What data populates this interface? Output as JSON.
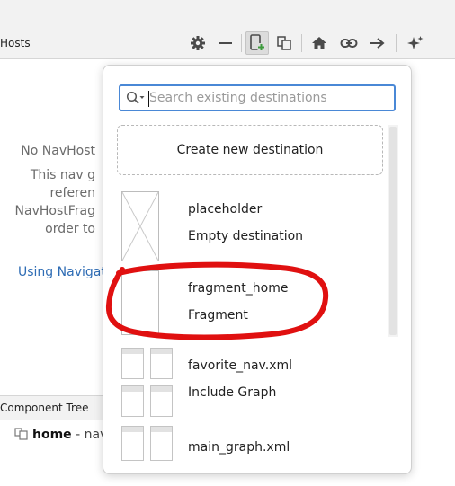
{
  "toolbar": {
    "title": "Hosts"
  },
  "host_panel": {
    "line1": "No NavHost",
    "line2": "This nav g",
    "line3": "referen",
    "line4": "NavHostFrag",
    "line5": "order to",
    "link": "Using Navigat"
  },
  "component_tree": {
    "title": "Component Tree",
    "row_name": "home",
    "row_suffix": "- nav"
  },
  "popup": {
    "search_placeholder": "Search existing destinations",
    "create_label": "Create new destination",
    "items": [
      {
        "name": "placeholder",
        "type": "Empty destination",
        "thumb": "empty-placeholder-thumbnail"
      },
      {
        "name": "fragment_home",
        "type": "Fragment",
        "thumb": "fragment-thumbnail"
      },
      {
        "name": "favorite_nav.xml",
        "type": "Include Graph",
        "thumb": "graph-thumbnail"
      },
      {
        "name": "main_graph.xml",
        "type": "",
        "thumb": "graph-thumbnail"
      }
    ]
  },
  "annotation": {
    "color": "#e01010",
    "target": "fragment_home"
  },
  "colors": {
    "accent": "#4a88d6",
    "link": "#2f6db5",
    "add_icon": "#3d9b3d"
  }
}
